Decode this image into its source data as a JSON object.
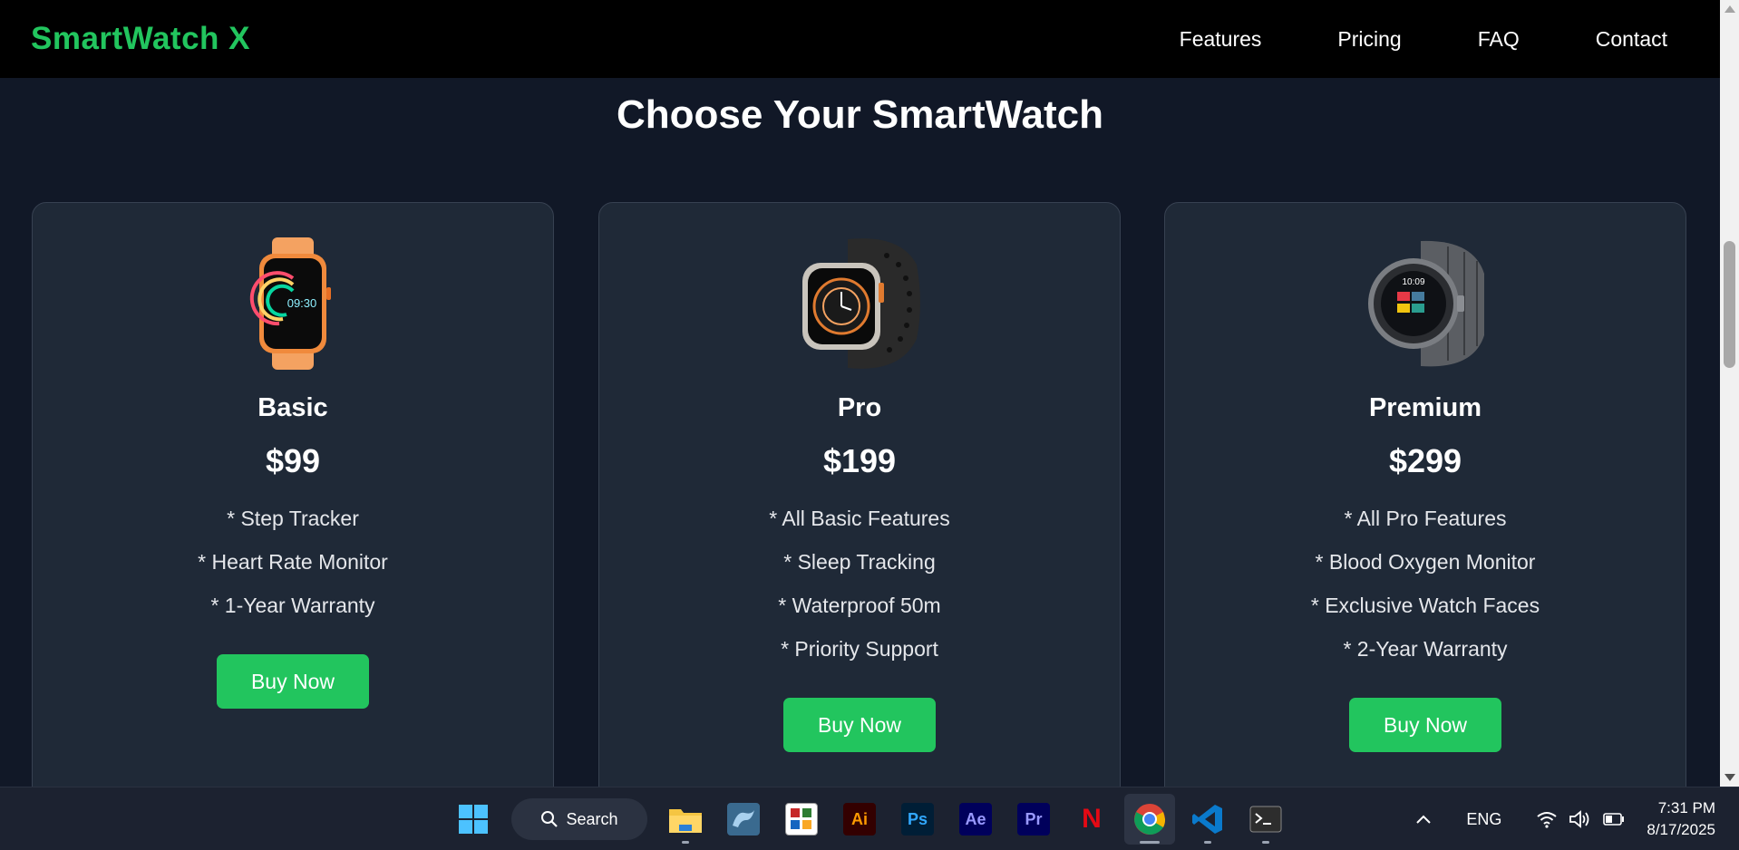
{
  "nav": {
    "brand": "SmartWatch X",
    "links": [
      "Features",
      "Pricing",
      "FAQ",
      "Contact"
    ]
  },
  "colors": {
    "accent": "#22c55e",
    "background": "#111827",
    "card": "#1f2937",
    "navbar": "#000000"
  },
  "main": {
    "title": "Choose Your SmartWatch",
    "plans": [
      {
        "name": "Basic",
        "price": "$99",
        "image_icon": "orange-smartwatch-image",
        "features": [
          "* Step Tracker",
          "* Heart Rate Monitor",
          "* 1-Year Warranty"
        ],
        "button": "Buy Now"
      },
      {
        "name": "Pro",
        "price": "$199",
        "image_icon": "black-band-smartwatch-image",
        "features": [
          "* All Basic Features",
          "* Sleep Tracking",
          "* Waterproof 50m",
          "* Priority Support"
        ],
        "button": "Buy Now"
      },
      {
        "name": "Premium",
        "price": "$299",
        "image_icon": "steel-smartwatch-image",
        "features": [
          "* All Pro Features",
          "* Blood Oxygen Monitor",
          "* Exclusive Watch Faces",
          "* 2-Year Warranty"
        ],
        "button": "Buy Now"
      }
    ],
    "basic_watch_time": "09:30",
    "premium_watch_time": "10:09"
  },
  "taskbar": {
    "search_label": "Search",
    "apps": [
      {
        "name": "windows-start-icon",
        "label": ""
      },
      {
        "name": "file-explorer-icon",
        "label": ""
      },
      {
        "name": "mysql-workbench-icon",
        "label": ""
      },
      {
        "name": "tally-icon",
        "label": ""
      },
      {
        "name": "illustrator-icon",
        "label": "Ai"
      },
      {
        "name": "photoshop-icon",
        "label": "Ps"
      },
      {
        "name": "after-effects-icon",
        "label": "Ae"
      },
      {
        "name": "premiere-pro-icon",
        "label": "Pr"
      },
      {
        "name": "netflix-icon",
        "label": "N"
      },
      {
        "name": "chrome-icon",
        "label": ""
      },
      {
        "name": "vscode-icon",
        "label": ""
      },
      {
        "name": "terminal-icon",
        "label": ""
      }
    ],
    "language": "ENG",
    "time": "7:31 PM",
    "date": "8/17/2025"
  }
}
